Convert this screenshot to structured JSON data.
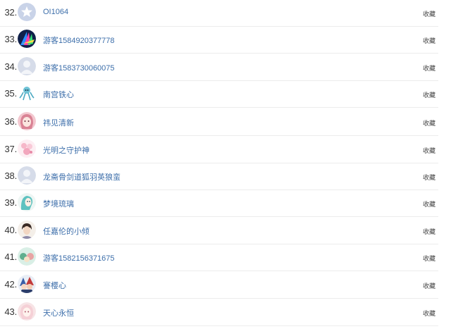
{
  "list": {
    "rows": [
      {
        "rank": "32.",
        "name": "OI1064",
        "action": "收藏",
        "avatar": "star-avatar-icon"
      },
      {
        "rank": "33.",
        "name": "游客1584920377778",
        "action": "收藏",
        "avatar": "abstract-light-avatar-icon"
      },
      {
        "rank": "34.",
        "name": "游客1583730060075",
        "action": "收藏",
        "avatar": "default-user-avatar-icon"
      },
      {
        "rank": "35.",
        "name": "南宫铁心",
        "action": "收藏",
        "avatar": "octopus-avatar-icon"
      },
      {
        "rank": "36.",
        "name": "祎见清新",
        "action": "收藏",
        "avatar": "anime-girl-avatar-icon"
      },
      {
        "rank": "37.",
        "name": "光明之守护神",
        "action": "收藏",
        "avatar": "anime-pink-avatar-icon"
      },
      {
        "rank": "38.",
        "name": "龙斋骨剑道狐羽英狼蛮",
        "action": "收藏",
        "avatar": "default-user-avatar-icon"
      },
      {
        "rank": "39.",
        "name": "梦境琉璃",
        "action": "收藏",
        "avatar": "anime-blue-hair-avatar-icon"
      },
      {
        "rank": "40.",
        "name": "任嘉伦的小倾",
        "action": "收藏",
        "avatar": "person-avatar-icon"
      },
      {
        "rank": "41.",
        "name": "游客1582156371675",
        "action": "收藏",
        "avatar": "anime-group-avatar-icon"
      },
      {
        "rank": "42.",
        "name": "謇樱心",
        "action": "收藏",
        "avatar": "anime-fighters-avatar-icon"
      },
      {
        "rank": "43.",
        "name": "天心永恒",
        "action": "收藏",
        "avatar": "anime-white-hair-avatar-icon"
      }
    ]
  }
}
